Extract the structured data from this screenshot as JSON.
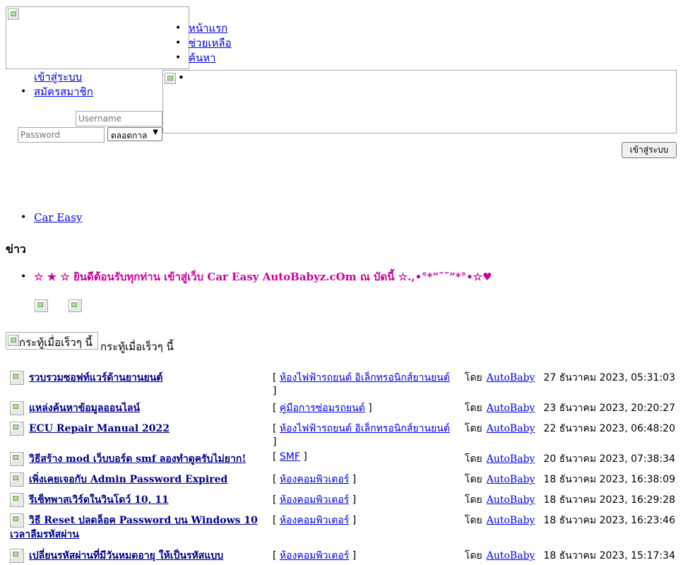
{
  "header": {
    "logo_alt": "",
    "menu": [
      {
        "label": "หน้าแรก"
      },
      {
        "label": "ช่วยเหลือ"
      },
      {
        "label": "ค้นหา"
      }
    ]
  },
  "login": {
    "links": [
      {
        "label": "เข้าสู่ระบบ"
      },
      {
        "label": "สมัครสมาชิก"
      }
    ],
    "username_placeholder": "Username",
    "password_placeholder": "Password",
    "duration_selected": "ตลอดกาล",
    "submit_label": "เข้าสู่ระบบ",
    "banner_alt": "•"
  },
  "breadcrumb": {
    "items": [
      {
        "label": "Car Easy"
      }
    ]
  },
  "news": {
    "heading": "ข่าว",
    "text": "☆ ★ ☆ ยินดีต้อนรับทุกท่าน เข้าสู่เว็บ Car Easy AutoBabyz.cOm  ณ บัดนี้  ☆.,•°*”˜˜”*°•☆♥"
  },
  "recent": {
    "icon_alt": "กระทู้เมื่อเร็วๆ นี้",
    "title": "กระทู้เมื่อเร็วๆ นี้",
    "by_label": "โดย",
    "topics": [
      {
        "subject": "รวบรวมซอฟท์แวร์ด้านยานยนต์",
        "board": "ห้องไฟฟ้ารถยนต์ อิเล็กทรอนิกส์ยานยนต์",
        "author": "AutoBaby",
        "date": "27 ธันวาคม 2023, 05:31:03"
      },
      {
        "subject": "แหล่งค้นหาข้อมูลออนไลน์",
        "board": "คู่มือการซ่อมรถยนต์",
        "author": "AutoBaby",
        "date": "23 ธันวาคม 2023, 20:20:27"
      },
      {
        "subject": "ECU Repair Manual 2022",
        "board": "ห้องไฟฟ้ารถยนต์ อิเล็กทรอนิกส์ยานยนต์",
        "author": "AutoBaby",
        "date": "22 ธันวาคม 2023, 06:48:20"
      },
      {
        "subject": "วิธีสร้าง mod เว็บบอร์ด smf ลองทำดูครับไม่ยาก!",
        "board": "SMF",
        "author": "AutoBaby",
        "date": "20 ธันวาคม 2023, 07:38:34"
      },
      {
        "subject": "เพิ่งเคยเจอกับ Admin Password Expired",
        "board": "ห้องคอมพิวเตอร์",
        "author": "AutoBaby",
        "date": "18 ธันวาคม 2023, 16:38:09"
      },
      {
        "subject": "รีเซ็ทพาสเวิร์ดในวินโดว์ 10, 11",
        "board": "ห้องคอมพิวเตอร์",
        "author": "AutoBaby",
        "date": "18 ธันวาคม 2023, 16:29:28"
      },
      {
        "subject": "วิธี Reset ปลดล็อค Password บน Windows 10 เวลาลืมรหัสผ่าน",
        "board": "ห้องคอมพิวเตอร์",
        "author": "AutoBaby",
        "date": "18 ธันวาคม 2023, 16:23:46"
      },
      {
        "subject": "เปลี่ยนรหัสผ่านที่มีวันหมดอายุ ให้เป็นรหัสแบบ",
        "board": "ห้องคอมพิวเตอร์",
        "author": "AutoBaby",
        "date": "18 ธันวาคม 2023, 15:17:34"
      }
    ]
  }
}
